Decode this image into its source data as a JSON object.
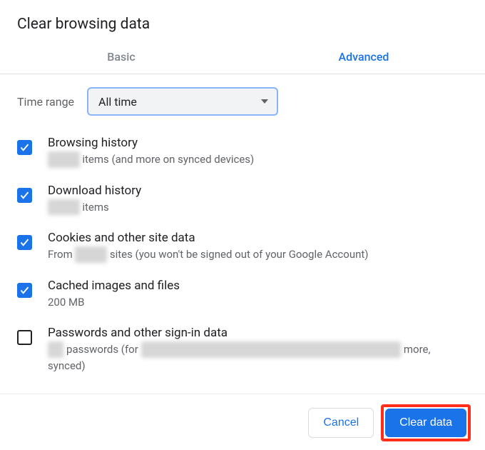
{
  "title": "Clear browsing data",
  "tabs": {
    "basic": "Basic",
    "advanced": "Advanced"
  },
  "time": {
    "label": "Time range",
    "selected": "All time"
  },
  "options": [
    {
      "title": "Browsing history",
      "pre": "",
      "mask": "xxxxxx",
      "post": " items (and more on synced devices)"
    },
    {
      "title": "Download history",
      "pre": "",
      "mask": "xxxxxx",
      "post": " items"
    },
    {
      "title": "Cookies and other site data",
      "pre": "From ",
      "mask": "xxxxxx",
      "post": " sites (you won't be signed out of your Google Account)"
    },
    {
      "title": "Cached images and files",
      "sub_plain": "200 MB"
    },
    {
      "title": "Passwords and other sign-in data",
      "pre_mask": "xxx",
      "mid1": " passwords (for ",
      "mid_mask": "xxxxxxxxxxxxxxxxxxxxxxxxxxxxxxxxxxxxxxxxxxxxxxxxx",
      "mid2": " more, synced)"
    }
  ],
  "buttons": {
    "cancel": "Cancel",
    "clear": "Clear data"
  }
}
